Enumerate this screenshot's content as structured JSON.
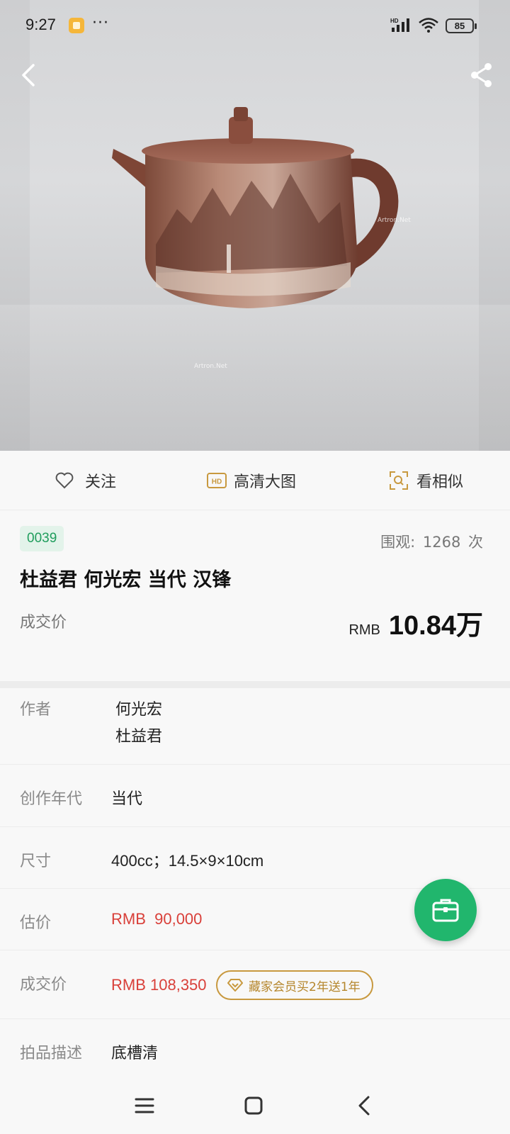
{
  "status_bar": {
    "time": "9:27",
    "overflow": "···",
    "network": "HD",
    "battery": "85"
  },
  "hero": {
    "watermark": "Artron.Net",
    "icons": {
      "back": "chevron-left-icon",
      "share": "share-icon"
    }
  },
  "actions": {
    "follow_label": "关注",
    "hd_badge": "HD",
    "hd_label": "高清大图",
    "similar_label": "看相似"
  },
  "lot": {
    "number": "0039",
    "views_label": "围观:",
    "views_count": "1268",
    "views_unit": "次",
    "title": "杜益君 何光宏 当代 汉锋",
    "sold_label": "成交价",
    "sold_currency": "RMB",
    "sold_amount": "10.84万"
  },
  "details": {
    "author_key": "作者",
    "author_values": [
      "何光宏",
      "杜益君"
    ],
    "period_key": "创作年代",
    "period_value": "当代",
    "size_key": "尺寸",
    "size_value": "400cc；14.5×9×10cm",
    "estimate_key": "估价",
    "estimate_value": "RMB  90,000",
    "hammer_key": "成交价",
    "hammer_value": "RMB 108,350",
    "vip_promo": "藏家会员买2年送1年",
    "desc_key": "拍品描述",
    "desc_value": "底槽清"
  },
  "colors": {
    "accent_green": "#21b66d",
    "price_red": "#d9403a",
    "gold": "#c8993f"
  },
  "sys_nav": {
    "icons": [
      "menu-icon",
      "home-square-icon",
      "back-icon"
    ]
  }
}
